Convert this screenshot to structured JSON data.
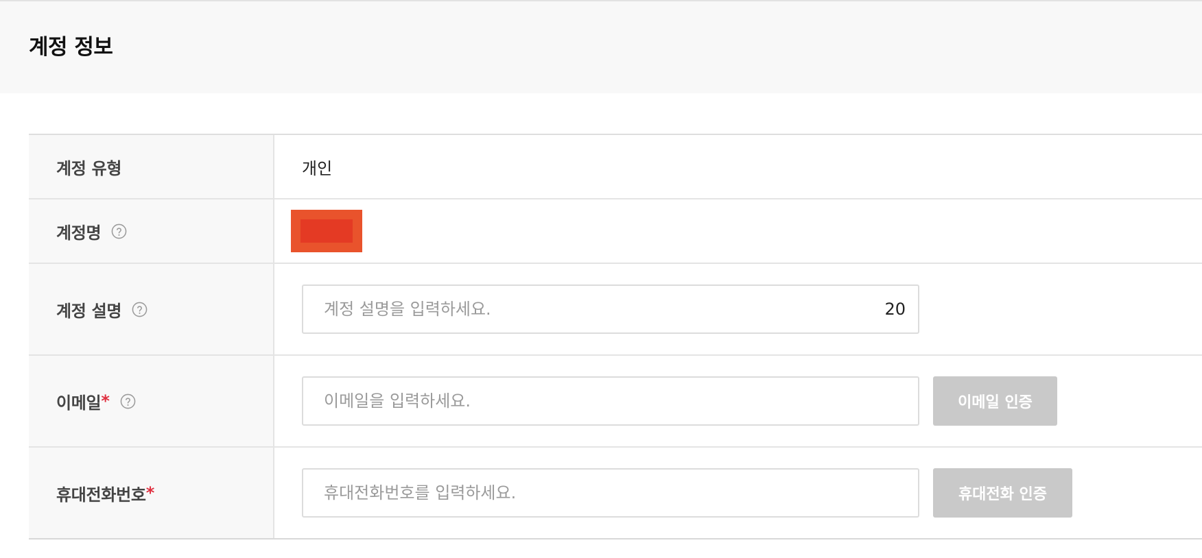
{
  "header": {
    "title": "계정 정보"
  },
  "form": {
    "account_type": {
      "label": "계정 유형",
      "value": "개인"
    },
    "account_name": {
      "label": "계정명",
      "help_icon": "question-circle-icon"
    },
    "account_description": {
      "label": "계정 설명",
      "help_icon": "question-circle-icon",
      "placeholder": "계정 설명을 입력하세요.",
      "value": "",
      "char_count": "20"
    },
    "email": {
      "label": "이메일",
      "required_mark": "*",
      "help_icon": "question-circle-icon",
      "placeholder": "이메일을 입력하세요.",
      "value": "",
      "verify_button": "이메일 인증"
    },
    "phone": {
      "label": "휴대전화번호",
      "required_mark": "*",
      "placeholder": "휴대전화번호를 입력하세요.",
      "value": "",
      "verify_button": "휴대전화 인증"
    }
  },
  "colors": {
    "required": "#e03040",
    "disabled_button": "#c9c9c9",
    "redaction": "#e9532c"
  }
}
